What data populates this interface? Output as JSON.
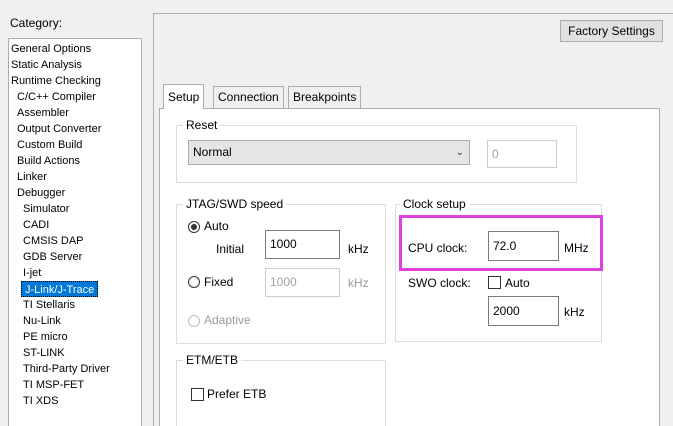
{
  "category": {
    "label": "Category:",
    "items": [
      {
        "label": "General Options",
        "level": 0
      },
      {
        "label": "Static Analysis",
        "level": 0
      },
      {
        "label": "Runtime Checking",
        "level": 0
      },
      {
        "label": "C/C++ Compiler",
        "level": 1
      },
      {
        "label": "Assembler",
        "level": 1
      },
      {
        "label": "Output Converter",
        "level": 1
      },
      {
        "label": "Custom Build",
        "level": 1
      },
      {
        "label": "Build Actions",
        "level": 1
      },
      {
        "label": "Linker",
        "level": 1
      },
      {
        "label": "Debugger",
        "level": 1
      },
      {
        "label": "Simulator",
        "level": 2
      },
      {
        "label": "CADI",
        "level": 2
      },
      {
        "label": "CMSIS DAP",
        "level": 2
      },
      {
        "label": "GDB Server",
        "level": 2
      },
      {
        "label": "I-jet",
        "level": 2
      },
      {
        "label": "J-Link/J-Trace",
        "level": 2,
        "selected": true
      },
      {
        "label": "TI Stellaris",
        "level": 2
      },
      {
        "label": "Nu-Link",
        "level": 2
      },
      {
        "label": "PE micro",
        "level": 2
      },
      {
        "label": "ST-LINK",
        "level": 2
      },
      {
        "label": "Third-Party Driver",
        "level": 2
      },
      {
        "label": "TI MSP-FET",
        "level": 2
      },
      {
        "label": "TI XDS",
        "level": 2
      }
    ]
  },
  "factory_settings": "Factory Settings",
  "tabs": [
    "Setup",
    "Connection",
    "Breakpoints"
  ],
  "reset": {
    "title": "Reset",
    "selected": "Normal",
    "value": "0"
  },
  "jtag": {
    "title": "JTAG/SWD speed",
    "auto_label": "Auto",
    "initial_label": "Initial",
    "initial_value": "1000",
    "initial_unit": "kHz",
    "fixed_label": "Fixed",
    "fixed_value": "1000",
    "fixed_unit": "kHz",
    "adaptive_label": "Adaptive"
  },
  "clock": {
    "title": "Clock setup",
    "cpu_label": "CPU clock:",
    "cpu_value": "72.0",
    "cpu_unit": "MHz",
    "swo_label": "SWO clock:",
    "swo_auto_label": "Auto",
    "swo_value": "2000",
    "swo_unit": "kHz"
  },
  "etm": {
    "title": "ETM/ETB",
    "prefer_label": "Prefer ETB"
  },
  "colors": {
    "highlight": "#e040e0",
    "selection": "#0078d7"
  }
}
